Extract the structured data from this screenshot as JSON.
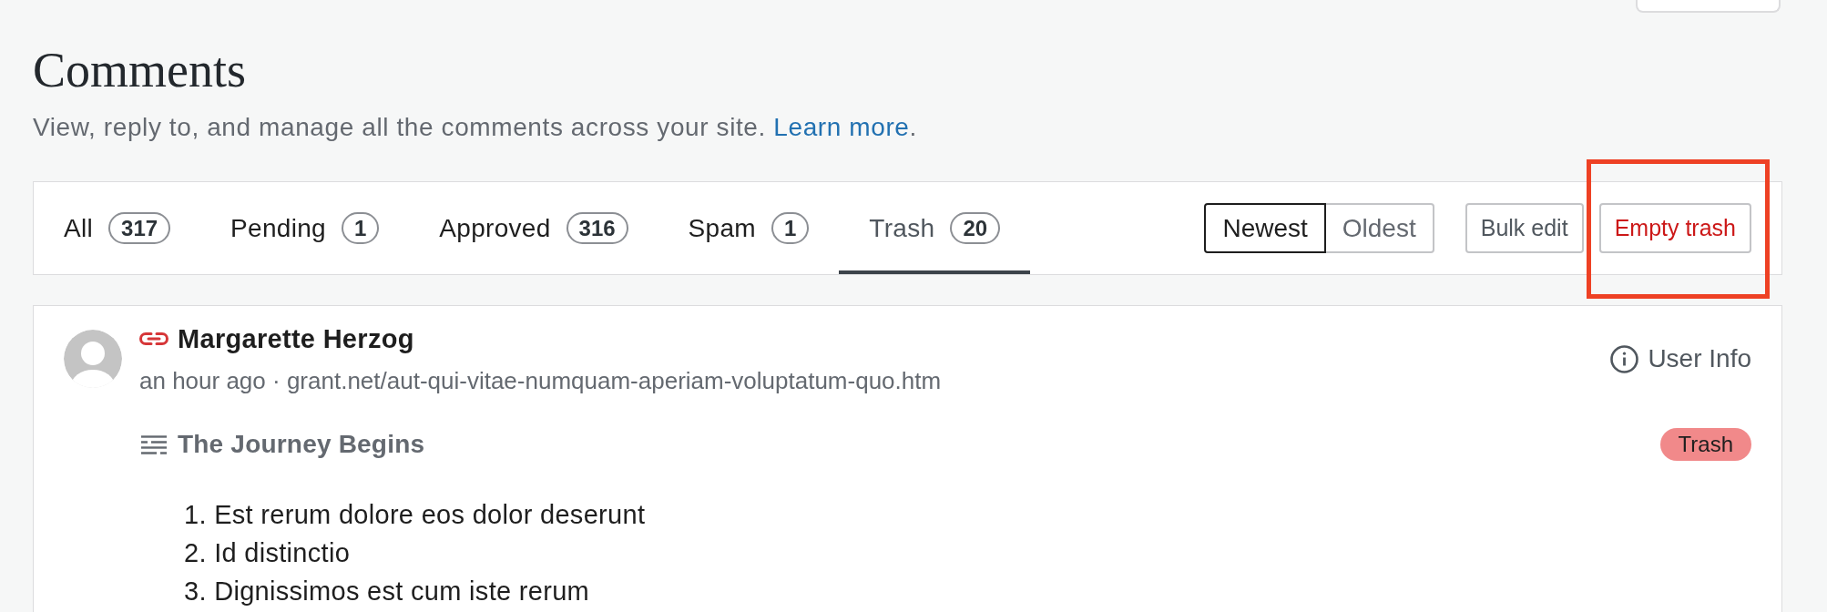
{
  "header": {
    "title": "Comments",
    "description": {
      "text": "View, reply to, and manage all the comments across your site.",
      "link": "Learn more",
      "after_link": "."
    }
  },
  "tabs": [
    {
      "label": "All",
      "count": "317",
      "selected": false
    },
    {
      "label": "Pending",
      "count": "1",
      "selected": false
    },
    {
      "label": "Approved",
      "count": "316",
      "selected": false
    },
    {
      "label": "Spam",
      "count": "1",
      "selected": false
    },
    {
      "label": "Trash",
      "count": "20",
      "selected": true
    }
  ],
  "sort": [
    {
      "label": "Newest",
      "selected": true
    },
    {
      "label": "Oldest",
      "selected": false
    }
  ],
  "actions": [
    {
      "label": "Bulk edit",
      "kind": "neutral",
      "highlighted": false
    },
    {
      "label": "Empty trash",
      "kind": "destructive",
      "highlighted": true
    }
  ],
  "comments": [
    {
      "author": "Margarette Herzog",
      "time": "an hour ago",
      "separator": "·",
      "url": "grant.net/aut-qui-vitae-numquam-aperiam-voluptatum-quo.htm",
      "user_info": "User Info",
      "post_title": "The Journey Begins",
      "status": "Trash",
      "body_list": [
        "1. Est rerum dolore eos dolor deserunt",
        "2. Id distinctio",
        "3. Dignissimos est cum iste rerum"
      ]
    }
  ]
}
